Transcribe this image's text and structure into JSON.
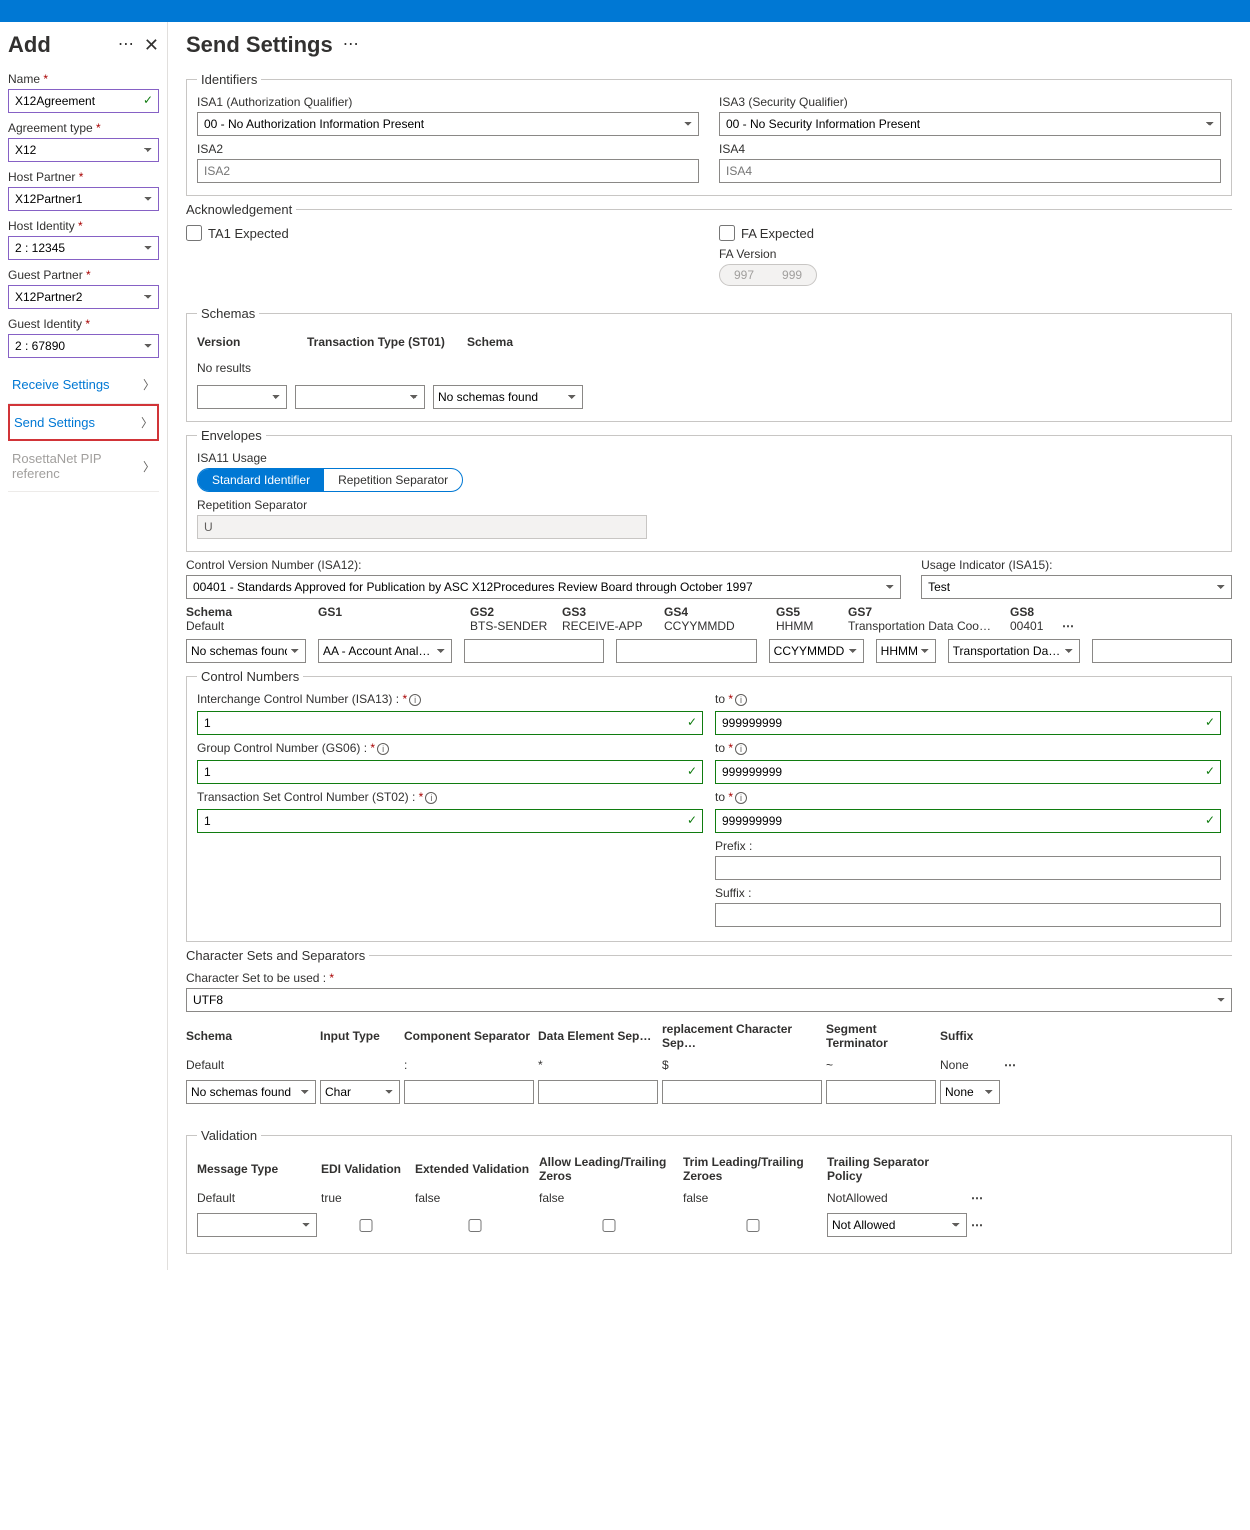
{
  "sidebar": {
    "title": "Add",
    "name": {
      "label": "Name",
      "value": "X12Agreement"
    },
    "agreementType": {
      "label": "Agreement type",
      "value": "X12"
    },
    "hostPartner": {
      "label": "Host Partner",
      "value": "X12Partner1"
    },
    "hostIdentity": {
      "label": "Host Identity",
      "value": "2 : 12345"
    },
    "guestPartner": {
      "label": "Guest Partner",
      "value": "X12Partner2"
    },
    "guestIdentity": {
      "label": "Guest Identity",
      "value": "2 : 67890"
    },
    "nav": {
      "receive": "Receive Settings",
      "send": "Send Settings",
      "rosetta": "RosettaNet PIP referenc"
    }
  },
  "main": {
    "title": "Send Settings",
    "identifiers": {
      "legend": "Identifiers",
      "isa1": {
        "label": "ISA1 (Authorization Qualifier)",
        "value": "00 - No Authorization Information Present"
      },
      "isa3": {
        "label": "ISA3 (Security Qualifier)",
        "value": "00 - No Security Information Present"
      },
      "isa2": {
        "label": "ISA2",
        "placeholder": "ISA2"
      },
      "isa4": {
        "label": "ISA4",
        "placeholder": "ISA4"
      }
    },
    "ack": {
      "legend": "Acknowledgement",
      "ta1": "TA1 Expected",
      "fa": "FA Expected",
      "faVersion": "FA Version",
      "v997": "997",
      "v999": "999"
    },
    "schemas": {
      "legend": "Schemas",
      "h1": "Version",
      "h2": "Transaction Type (ST01)",
      "h3": "Schema",
      "noResults": "No results",
      "noSchemas": "No schemas found"
    },
    "envelopes": {
      "legend": "Envelopes",
      "isa11": "ISA11 Usage",
      "std": "Standard Identifier",
      "rep": "Repetition Separator",
      "repSep": "Repetition Separator",
      "repVal": "U",
      "cvnLabel": "Control Version Number (ISA12):",
      "cvnValue": "00401 - Standards Approved for Publication by ASC X12Procedures Review Board through October 1997",
      "usageLabel": "Usage Indicator (ISA15):",
      "usageValue": "Test",
      "head": {
        "sch": "Schema",
        "gs1": "GS1",
        "gs2": "GS2",
        "gs3": "GS3",
        "gs4": "GS4",
        "gs5": "GS5",
        "gs7": "GS7",
        "gs8": "GS8"
      },
      "row": {
        "sch": "Default",
        "gs1": "",
        "gs2": "BTS-SENDER",
        "gs3": "RECEIVE-APP",
        "gs4": "CCYYMMDD",
        "gs5": "HHMM",
        "gs7": "Transportation Data Coo…",
        "gs8": "00401"
      },
      "sel": {
        "sch": "No schemas found",
        "gs1": "AA - Account Anal…",
        "gs4": "CCYYMMDD",
        "gs5": "HHMM",
        "gs7": "Transportation Da…"
      }
    },
    "control": {
      "legend": "Control Numbers",
      "icnLabel": "Interchange Control Number (ISA13) :",
      "gcnLabel": "Group Control Number (GS06) :",
      "tscLabel": "Transaction Set Control Number (ST02) :",
      "to": "to",
      "from": "1",
      "toVal": "999999999",
      "prefix": "Prefix :",
      "suffix": "Suffix :"
    },
    "charset": {
      "legend": "Character Sets and Separators",
      "csLabel": "Character Set to be used :",
      "csValue": "UTF8",
      "head": {
        "sch": "Schema",
        "it": "Input Type",
        "cs": "Component Separator",
        "de": "Data Element Sep…",
        "rc": "replacement Character Sep…",
        "st": "Segment Terminator",
        "sf": "Suffix"
      },
      "row": {
        "sch": "Default",
        "it": "",
        "cs": ":",
        "de": "*",
        "rc": "$",
        "st": "~",
        "sf": "None"
      },
      "sel": {
        "sch": "No schemas found",
        "it": "Char",
        "sf": "None"
      }
    },
    "validation": {
      "legend": "Validation",
      "head": {
        "mt": "Message Type",
        "edi": "EDI Validation",
        "ext": "Extended Validation",
        "alz": "Allow Leading/Trailing Zeros",
        "tlz": "Trim Leading/Trailing Zeroes",
        "tsp": "Trailing Separator Policy"
      },
      "row": {
        "mt": "Default",
        "edi": "true",
        "ext": "false",
        "alz": "false",
        "tlz": "false",
        "tsp": "NotAllowed"
      },
      "tspSel": "Not Allowed"
    }
  }
}
